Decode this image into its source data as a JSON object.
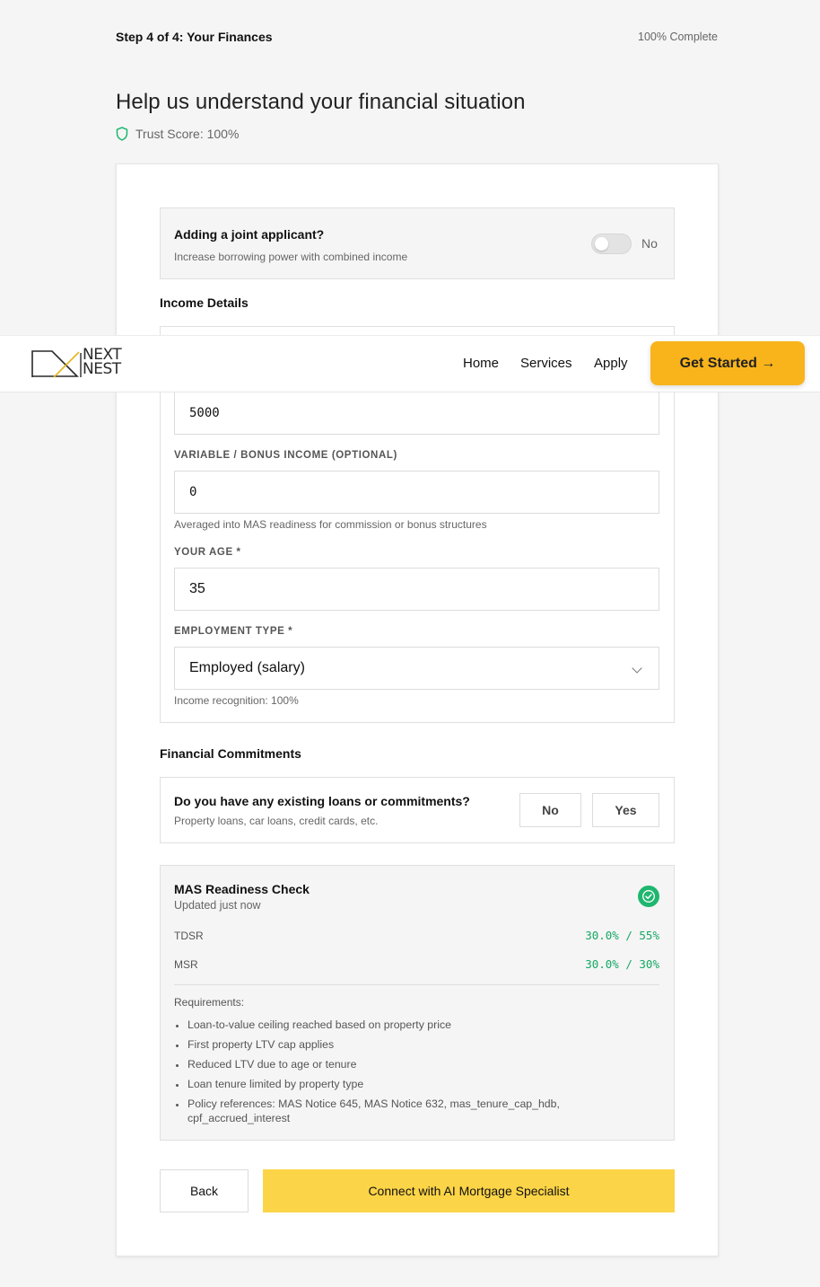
{
  "header": {
    "step": "Step 4 of 4: Your Finances",
    "progress_text": "100% Complete",
    "title": "Help us understand your financial situation",
    "trust_score": "Trust Score: 100%"
  },
  "joint_applicant": {
    "title": "Adding a joint applicant?",
    "subtitle": "Increase borrowing power with combined income",
    "toggle_state": "No"
  },
  "income": {
    "section_title": "Income Details",
    "monthly_income_value": "5000",
    "variable_label": "VARIABLE / BONUS INCOME (OPTIONAL)",
    "variable_value": "0",
    "variable_hint": "Averaged into MAS readiness for commission or bonus structures",
    "age_label": "YOUR AGE *",
    "age_value": "35",
    "employment_label": "EMPLOYMENT TYPE *",
    "employment_value": "Employed (salary)",
    "employment_hint": "Income recognition: 100%"
  },
  "navbar": {
    "logo_text_1": "NEXT",
    "logo_text_2": "NEST",
    "links": [
      "Home",
      "Services",
      "Apply"
    ],
    "cta": "Get Started →"
  },
  "commitments": {
    "section_title": "Financial Commitments",
    "question": "Do you have any existing loans or commitments?",
    "subtitle": "Property loans, car loans, credit cards, etc.",
    "no_label": "No",
    "yes_label": "Yes"
  },
  "mas": {
    "title": "MAS Readiness Check",
    "updated": "Updated just now",
    "metrics": [
      {
        "label": "TDSR",
        "value": "30.0% / 55%"
      },
      {
        "label": "MSR",
        "value": "30.0% / 30%"
      }
    ],
    "requirements_label": "Requirements:",
    "requirements": [
      "Loan-to-value ceiling reached based on property price",
      "First property LTV cap applies",
      "Reduced LTV due to age or tenure",
      "Loan tenure limited by property type",
      "Policy references: MAS Notice 645, MAS Notice 632, mas_tenure_cap_hdb, cpf_accrued_interest"
    ]
  },
  "actions": {
    "back": "Back",
    "connect": "Connect with AI Mortgage Specialist"
  },
  "colors": {
    "accent_yellow": "#fcd447",
    "cta_orange": "#f9b41c",
    "success_green": "#1fb66f"
  }
}
